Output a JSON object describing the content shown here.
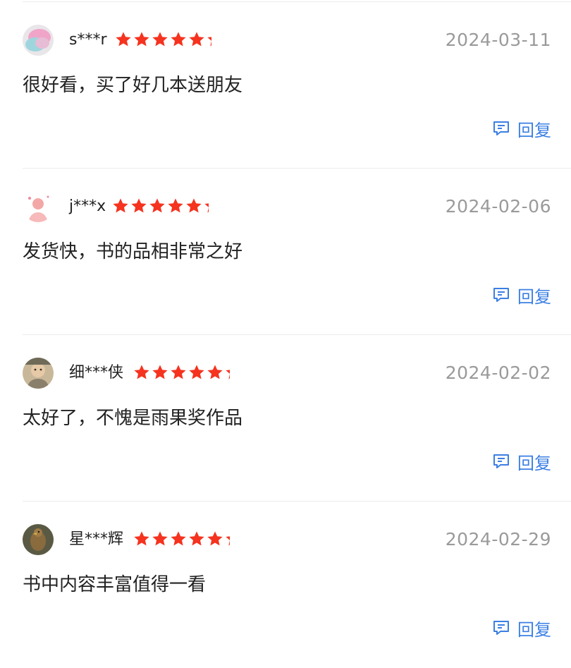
{
  "colors": {
    "star": "#f5331f",
    "reply": "#3b7fe3",
    "date": "#9a9a9a",
    "text": "#222222"
  },
  "reviews": [
    {
      "username": "s***r",
      "rating": 5,
      "date": "2024-03-11",
      "content": "很好看，买了好几本送朋友",
      "reply_label": "回复",
      "reply_icon": "comment-icon",
      "avatar": "avatar-pink-blue-blob"
    },
    {
      "username": "j***x",
      "rating": 5,
      "date": "2024-02-06",
      "content": "发货快，书的品相非常之好",
      "reply_label": "回复",
      "reply_icon": "comment-icon",
      "avatar": "avatar-pink-figure"
    },
    {
      "username": "细***侠",
      "rating": 5,
      "date": "2024-02-02",
      "content": "太好了，不愧是雨果奖作品",
      "reply_label": "回复",
      "reply_icon": "comment-icon",
      "avatar": "avatar-child-photo"
    },
    {
      "username": "星***辉",
      "rating": 5,
      "date": "2024-02-29",
      "content": "书中内容丰富值得一看",
      "reply_label": "回复",
      "reply_icon": "comment-icon",
      "avatar": "avatar-bird-photo"
    }
  ]
}
